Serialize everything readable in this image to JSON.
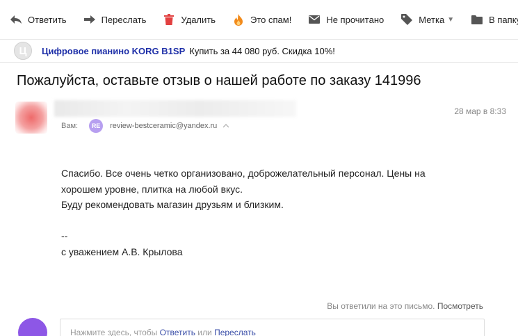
{
  "toolbar": {
    "reply_label": "Ответить",
    "forward_label": "Переслать",
    "delete_label": "Удалить",
    "spam_label": "Это спам!",
    "unread_label": "Не прочитано",
    "label_label": "Метка",
    "folder_label": "В папку"
  },
  "ad": {
    "logo_letter": "Ц",
    "title": "Цифровое пианино KORG B1SP",
    "text": "Купить за 44 080 руб. Скидка 10%!"
  },
  "message": {
    "subject": "Пожалуйста, оставьте отзыв о нашей работе по заказу 141996",
    "date": "28 мар в 8:33",
    "to_label": "Вам:",
    "recipient_badge": "RE",
    "recipient_email": "review-bestceramic@yandex.ru",
    "body_lines": [
      "Спасибо. Все очень четко организовано, доброжелательный персонал. Цены на",
      "хорошем уровне, плитка на любой вкус.",
      "Буду рекомендовать магазин друзьям и близким."
    ],
    "signature_dash": "--",
    "signature": "с уважением А.В. Крылова"
  },
  "replied_notice": {
    "text": "Вы ответили на это письмо.",
    "link": "Посмотреть"
  },
  "quick_reply": {
    "prefix": "Нажмите здесь, чтобы",
    "reply_link": "Ответить",
    "or": "или",
    "forward_link": "Переслать"
  },
  "colors": {
    "ad_title": "#1e2fa8",
    "spam_icon": "#f28a1a",
    "delete_icon": "#e24040",
    "badge": "#b79ff0",
    "reply_avatar": "#8d57e6"
  }
}
